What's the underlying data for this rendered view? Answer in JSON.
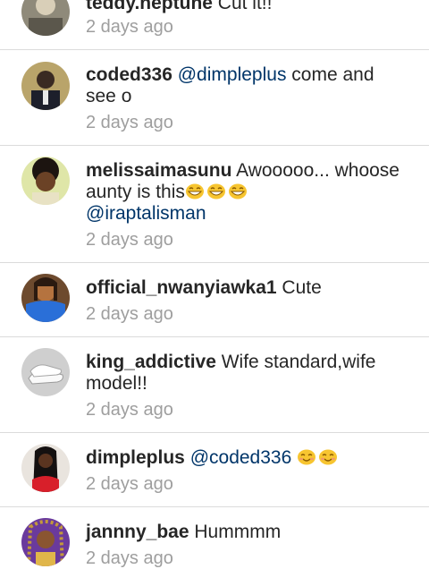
{
  "colors": {
    "username": "#262626",
    "mention": "#003569",
    "timestamp": "#9e9e9e",
    "divider": "#dbdbdb"
  },
  "comments": [
    {
      "username": "teddy.neptune",
      "text": " Cut it!!",
      "time": "2 days ago"
    },
    {
      "username": "coded336",
      "mention": "@dimpleplus",
      "text": " come and see o",
      "time": "2 days ago"
    },
    {
      "username": "melissaimasunu",
      "text": " Awooooo... whoose aunty is this",
      "emoji": "grinning-face-emoji",
      "mention": "@iraptalisman",
      "time": "2 days ago"
    },
    {
      "username": "official_nwanyiawka1",
      "text": " Cute",
      "time": "2 days ago"
    },
    {
      "username": "king_addictive",
      "text": " Wife standard,wife model!!",
      "time": "2 days ago"
    },
    {
      "username": "dimpleplus",
      "mention": "@coded336",
      "emoji": "smiling-face-emoji",
      "time": "2 days ago"
    },
    {
      "username": "jannny_bae",
      "text": " Hummmm",
      "time": "2 days ago"
    }
  ]
}
